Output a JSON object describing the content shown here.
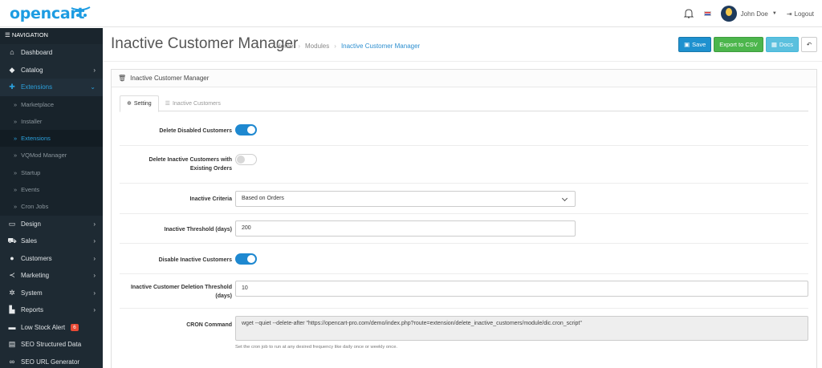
{
  "header": {
    "logo": "opencart",
    "user_name": "John Doe",
    "logout_label": "Logout"
  },
  "sidebar": {
    "title": "NAVIGATION",
    "items": [
      {
        "label": "Dashboard",
        "icon": "home-icon"
      },
      {
        "label": "Catalog",
        "icon": "tag-icon",
        "arrow": true
      },
      {
        "label": "Extensions",
        "icon": "puzzle-icon",
        "arrow": true,
        "active": true
      },
      {
        "label": "Design",
        "icon": "monitor-icon",
        "arrow": true
      },
      {
        "label": "Sales",
        "icon": "cart-icon",
        "arrow": true
      },
      {
        "label": "Customers",
        "icon": "user-icon",
        "arrow": true
      },
      {
        "label": "Marketing",
        "icon": "share-icon",
        "arrow": true
      },
      {
        "label": "System",
        "icon": "gear-icon",
        "arrow": true
      },
      {
        "label": "Reports",
        "icon": "bar-chart-icon",
        "arrow": true
      },
      {
        "label": "Low Stock Alert",
        "icon": "ticket-icon",
        "badge": "6"
      },
      {
        "label": "SEO Structured Data",
        "icon": "card-icon"
      },
      {
        "label": "SEO URL Generator",
        "icon": "link-icon"
      }
    ],
    "extensions_sub": [
      "Marketplace",
      "Installer",
      "Extensions",
      "VQMod Manager",
      "Startup",
      "Events",
      "Cron Jobs"
    ]
  },
  "page": {
    "title": "Inactive Customer Manager",
    "breadcrumb": [
      "Home",
      "Modules",
      "Inactive Customer Manager"
    ],
    "buttons": {
      "save": "Save",
      "export": "Export to CSV",
      "docs": "Docs"
    },
    "panel_title": "Inactive Customer Manager",
    "tabs": {
      "setting": "Setting",
      "inactive": "Inactive Customers"
    }
  },
  "form": {
    "delete_disabled_label": "Delete Disabled Customers",
    "delete_disabled_on": true,
    "delete_inactive_orders_label_1": "Delete Inactive Customers with",
    "delete_inactive_orders_label_2": "Existing Orders",
    "delete_inactive_orders_on": false,
    "criteria_label": "Inactive Criteria",
    "criteria_value": "Based on Orders",
    "threshold_label": "Inactive Threshold (days)",
    "threshold_value": "200",
    "disable_label": "Disable Inactive Customers",
    "disable_on": true,
    "deletion_threshold_label_1": "Inactive Customer Deletion Threshold",
    "deletion_threshold_label_2": "(days)",
    "deletion_threshold_value": "10",
    "cron_label": "CRON Command",
    "cron_value": "wget --quiet --delete-after \"https://opencart-pro.com/demo/index.php?route=extension/delete_inactive_customers/module/dic.cron_script\"",
    "cron_help": "Set the cron job to run at any desired frequency like daily once or weekly once."
  }
}
